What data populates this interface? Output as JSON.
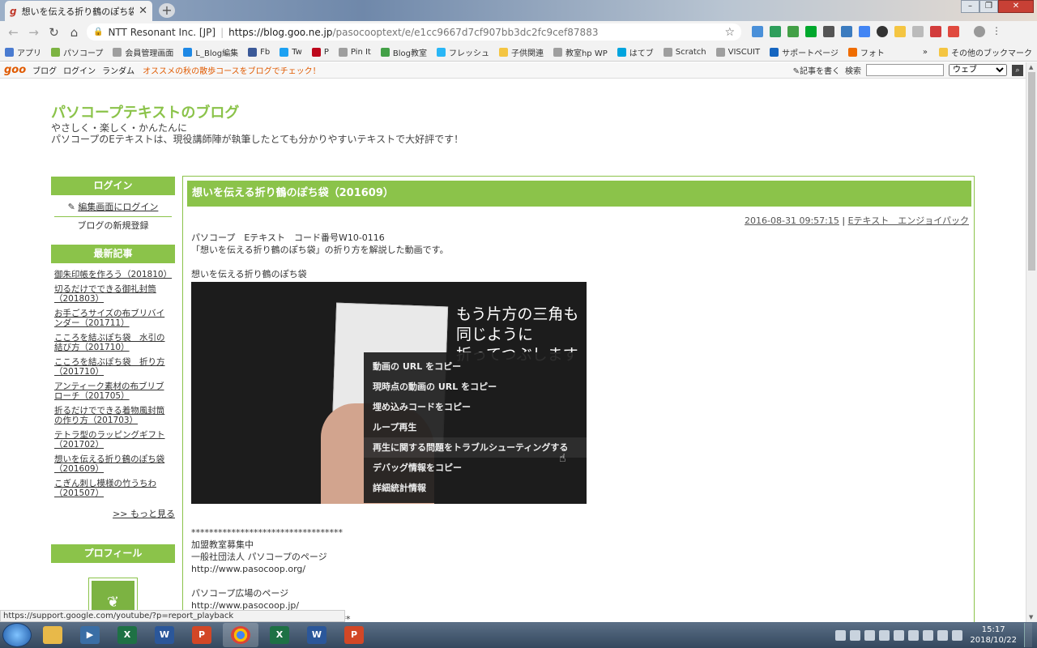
{
  "browser": {
    "tab_title": "想いを伝える折り鶴のぽち袋（2",
    "site_org": "NTT Resonant Inc. [JP]",
    "url_host": "https://blog.goo.ne.jp",
    "url_path": "/pasocooptext/e/e1cc9667d7cf907bb3dc2fc9cef87883"
  },
  "bookmarks": [
    {
      "label": "アプリ",
      "color": "#4a7bd0"
    },
    {
      "label": "パソコープ",
      "color": "#7cb342"
    },
    {
      "label": "会員管理画面",
      "color": "#9e9e9e"
    },
    {
      "label": "L_Blog編集",
      "color": "#1e88e5"
    },
    {
      "label": "Fb",
      "color": "#3b5998"
    },
    {
      "label": "Tw",
      "color": "#1da1f2"
    },
    {
      "label": "P",
      "color": "#bd081c"
    },
    {
      "label": "Pin It",
      "color": "#9e9e9e"
    },
    {
      "label": "Blog教室",
      "color": "#43a047"
    },
    {
      "label": "フレッシュ",
      "color": "#29b6f6"
    },
    {
      "label": "子供関連",
      "color": "#f4c542"
    },
    {
      "label": "教室hp WP",
      "color": "#9e9e9e"
    },
    {
      "label": "はてブ",
      "color": "#00a4de"
    },
    {
      "label": "Scratch",
      "color": "#9e9e9e"
    },
    {
      "label": "VISCUIT",
      "color": "#9e9e9e"
    },
    {
      "label": "サポートページ",
      "color": "#1565c0"
    },
    {
      "label": "フォト",
      "color": "#ef6c00"
    }
  ],
  "bookmarks_overflow": "»",
  "bookmarks_other": "その他のブックマーク",
  "goo_bar": {
    "logo": "goo",
    "links": [
      "ブログ",
      "ログイン",
      "ランダム"
    ],
    "promo": "オススメの秋の散歩コースをブログでチェック！",
    "write": "記事を書く",
    "search_label": "検索",
    "search_value": "",
    "select_value": "ウェブ"
  },
  "blog": {
    "title": "パソコープテキストのブログ",
    "desc_line1": "やさしく・楽しく・かんたんに",
    "desc_line2": "パソコープのEテキストは、現役講師陣が執筆したとても分かりやすいテキストで大好評です！"
  },
  "sidebar": {
    "login_head": "ログイン",
    "login_link": "編集画面にログイン",
    "register_link": "ブログの新規登録",
    "recent_head": "最新記事",
    "recent": [
      "御朱印帳を作ろう（201810）",
      "切るだけでできる御礼封筒（201803）",
      "お手ごろサイズの布ブリバインダー（201711）",
      "こころを結ぶぽち袋　水引の結び方（201710）",
      "こころを結ぶぽち袋　折り方（201710）",
      "アンティーク素材の布ブリブローチ（201705）",
      "折るだけでできる着物風封筒の作り方（201703）",
      "テトラ型のラッピングギフト（201702）",
      "想いを伝える折り鶴のぽち袋（201609）",
      "こぎん刺し模様の竹うちわ（201507）"
    ],
    "more": ">> もっと見る",
    "profile_head": "プロフィール"
  },
  "article": {
    "title": "想いを伝える折り鶴のぽち袋（201609）",
    "date": "2016-08-31 09:57:15",
    "meta_sep": "|",
    "category": "Eテキスト　エンジョイパック",
    "line1": "パソコープ　Eテキスト　コード番号W10-0116",
    "line2": "「想いを伝える折り鶴のぽち袋」の折り方を解説した動画です。",
    "video_label": "想いを伝える折り鶴のぽち袋",
    "video_caption_1": "もう片方の三角も",
    "video_caption_2": "同じように",
    "video_caption_3": "折ってつぶします",
    "stars": "**********************************",
    "p1": "加盟教室募集中",
    "p2": "一般社団法人 パソコープのページ",
    "p3": "http://www.pasocoop.org/",
    "p4": "パソコープ広場のページ",
    "p5": "http://www.pasocoop.jp/",
    "stars_tail": "***"
  },
  "context_menu": [
    "動画の URL をコピー",
    "現時点の動画の URL をコピー",
    "埋め込みコードをコピー",
    "ループ再生",
    "再生に関する問題をトラブルシューティングする",
    "デバッグ情報をコピー",
    "詳細統計情報"
  ],
  "status_url": "https://support.google.com/youtube/?p=report_playback",
  "taskbar": {
    "time": "15:17",
    "date": "2018/10/22"
  }
}
